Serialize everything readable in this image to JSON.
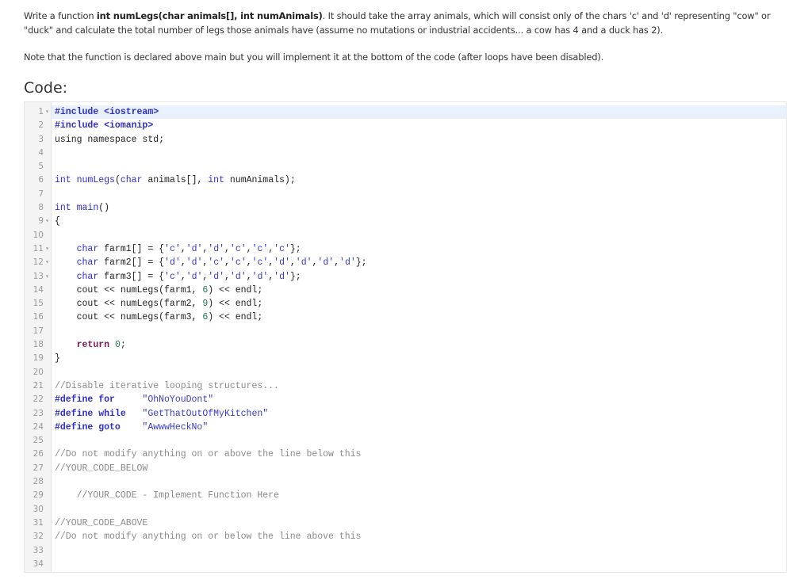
{
  "prompt": {
    "p1_pre": "Write a function ",
    "p1_bold": "int numLegs(char animals[], int numAnimals)",
    "p1_post": ". It should take the array animals, which will consist only of the chars 'c' and 'd' representing \"cow\" or \"duck\" and calculate the total number of legs those animals have (assume no mutations or industrial accidents... a cow has 4 and a duck has 2).",
    "p2": "Note that the function is declared above main but you will implement it at the bottom of the code (after loops have been disabled)."
  },
  "heading": "Code:",
  "editor": {
    "active_line": 1,
    "lines": [
      {
        "n": "1",
        "fold": true,
        "tokens": [
          {
            "t": "pp",
            "v": "#include <iostream>"
          }
        ]
      },
      {
        "n": "2",
        "fold": false,
        "tokens": [
          {
            "t": "pp",
            "v": "#include <iomanip>"
          }
        ]
      },
      {
        "n": "3",
        "fold": false,
        "tokens": [
          {
            "t": "",
            "v": "using namespace std;"
          }
        ]
      },
      {
        "n": "4",
        "fold": false,
        "tokens": []
      },
      {
        "n": "5",
        "fold": false,
        "tokens": []
      },
      {
        "n": "6",
        "fold": false,
        "tokens": [
          {
            "t": "kw",
            "v": "int"
          },
          {
            "t": "",
            "v": " "
          },
          {
            "t": "kw",
            "v": "numLegs"
          },
          {
            "t": "",
            "v": "("
          },
          {
            "t": "kw",
            "v": "char"
          },
          {
            "t": "",
            "v": " animals[], "
          },
          {
            "t": "kw",
            "v": "int"
          },
          {
            "t": "",
            "v": " numAnimals);"
          }
        ]
      },
      {
        "n": "7",
        "fold": false,
        "tokens": []
      },
      {
        "n": "8",
        "fold": false,
        "tokens": [
          {
            "t": "kw",
            "v": "int"
          },
          {
            "t": "",
            "v": " "
          },
          {
            "t": "kw",
            "v": "main"
          },
          {
            "t": "",
            "v": "()"
          }
        ]
      },
      {
        "n": "9",
        "fold": true,
        "tokens": [
          {
            "t": "",
            "v": "{"
          }
        ]
      },
      {
        "n": "10",
        "fold": false,
        "tokens": []
      },
      {
        "n": "11",
        "fold": true,
        "tokens": [
          {
            "t": "",
            "v": "    "
          },
          {
            "t": "kw",
            "v": "char"
          },
          {
            "t": "",
            "v": " farm1[] = {"
          },
          {
            "t": "str",
            "v": "'c'"
          },
          {
            "t": "",
            "v": ","
          },
          {
            "t": "str",
            "v": "'d'"
          },
          {
            "t": "",
            "v": ","
          },
          {
            "t": "str",
            "v": "'d'"
          },
          {
            "t": "",
            "v": ","
          },
          {
            "t": "str",
            "v": "'c'"
          },
          {
            "t": "",
            "v": ","
          },
          {
            "t": "str",
            "v": "'c'"
          },
          {
            "t": "",
            "v": ","
          },
          {
            "t": "str",
            "v": "'c'"
          },
          {
            "t": "",
            "v": "};"
          }
        ]
      },
      {
        "n": "12",
        "fold": true,
        "tokens": [
          {
            "t": "",
            "v": "    "
          },
          {
            "t": "kw",
            "v": "char"
          },
          {
            "t": "",
            "v": " farm2[] = {"
          },
          {
            "t": "str",
            "v": "'d'"
          },
          {
            "t": "",
            "v": ","
          },
          {
            "t": "str",
            "v": "'d'"
          },
          {
            "t": "",
            "v": ","
          },
          {
            "t": "str",
            "v": "'c'"
          },
          {
            "t": "",
            "v": ","
          },
          {
            "t": "str",
            "v": "'c'"
          },
          {
            "t": "",
            "v": ","
          },
          {
            "t": "str",
            "v": "'c'"
          },
          {
            "t": "",
            "v": ","
          },
          {
            "t": "str",
            "v": "'d'"
          },
          {
            "t": "",
            "v": ","
          },
          {
            "t": "str",
            "v": "'d'"
          },
          {
            "t": "",
            "v": ","
          },
          {
            "t": "str",
            "v": "'d'"
          },
          {
            "t": "",
            "v": ","
          },
          {
            "t": "str",
            "v": "'d'"
          },
          {
            "t": "",
            "v": "};"
          }
        ]
      },
      {
        "n": "13",
        "fold": true,
        "tokens": [
          {
            "t": "",
            "v": "    "
          },
          {
            "t": "kw",
            "v": "char"
          },
          {
            "t": "",
            "v": " farm3[] = {"
          },
          {
            "t": "str",
            "v": "'c'"
          },
          {
            "t": "",
            "v": ","
          },
          {
            "t": "str",
            "v": "'d'"
          },
          {
            "t": "",
            "v": ","
          },
          {
            "t": "str",
            "v": "'d'"
          },
          {
            "t": "",
            "v": ","
          },
          {
            "t": "str",
            "v": "'d'"
          },
          {
            "t": "",
            "v": ","
          },
          {
            "t": "str",
            "v": "'d'"
          },
          {
            "t": "",
            "v": ","
          },
          {
            "t": "str",
            "v": "'d'"
          },
          {
            "t": "",
            "v": "};"
          }
        ]
      },
      {
        "n": "14",
        "fold": false,
        "tokens": [
          {
            "t": "",
            "v": "    cout << numLegs(farm1, "
          },
          {
            "t": "num",
            "v": "6"
          },
          {
            "t": "",
            "v": ") << endl;"
          }
        ]
      },
      {
        "n": "15",
        "fold": false,
        "tokens": [
          {
            "t": "",
            "v": "    cout << numLegs(farm2, "
          },
          {
            "t": "num",
            "v": "9"
          },
          {
            "t": "",
            "v": ") << endl;"
          }
        ]
      },
      {
        "n": "16",
        "fold": false,
        "tokens": [
          {
            "t": "",
            "v": "    cout << numLegs(farm3, "
          },
          {
            "t": "num",
            "v": "6"
          },
          {
            "t": "",
            "v": ") << endl;"
          }
        ]
      },
      {
        "n": "17",
        "fold": false,
        "tokens": []
      },
      {
        "n": "18",
        "fold": false,
        "tokens": [
          {
            "t": "",
            "v": "    "
          },
          {
            "t": "ret",
            "v": "return"
          },
          {
            "t": "",
            "v": " "
          },
          {
            "t": "num",
            "v": "0"
          },
          {
            "t": "",
            "v": ";"
          }
        ]
      },
      {
        "n": "19",
        "fold": false,
        "tokens": [
          {
            "t": "",
            "v": "}"
          }
        ]
      },
      {
        "n": "20",
        "fold": false,
        "tokens": []
      },
      {
        "n": "21",
        "fold": false,
        "tokens": [
          {
            "t": "cm",
            "v": "//Disable iterative looping structures..."
          }
        ]
      },
      {
        "n": "22",
        "fold": false,
        "tokens": [
          {
            "t": "pp",
            "v": "#define for     "
          },
          {
            "t": "str",
            "v": "\"OhNoYouDont\""
          }
        ]
      },
      {
        "n": "23",
        "fold": false,
        "tokens": [
          {
            "t": "pp",
            "v": "#define while   "
          },
          {
            "t": "str",
            "v": "\"GetThatOutOfMyKitchen\""
          }
        ]
      },
      {
        "n": "24",
        "fold": false,
        "tokens": [
          {
            "t": "pp",
            "v": "#define goto    "
          },
          {
            "t": "str",
            "v": "\"AwwwHeckNo\""
          }
        ]
      },
      {
        "n": "25",
        "fold": false,
        "tokens": []
      },
      {
        "n": "26",
        "fold": false,
        "tokens": [
          {
            "t": "cm",
            "v": "//Do not modify anything on or above the line below this"
          }
        ]
      },
      {
        "n": "27",
        "fold": false,
        "tokens": [
          {
            "t": "cm",
            "v": "//YOUR_CODE_BELOW"
          }
        ]
      },
      {
        "n": "28",
        "fold": false,
        "tokens": []
      },
      {
        "n": "29",
        "fold": false,
        "tokens": [
          {
            "t": "cm",
            "v": "    //YOUR_CODE - Implement Function Here"
          }
        ]
      },
      {
        "n": "30",
        "fold": false,
        "tokens": []
      },
      {
        "n": "31",
        "fold": false,
        "tokens": [
          {
            "t": "cm",
            "v": "//YOUR_CODE_ABOVE"
          }
        ]
      },
      {
        "n": "32",
        "fold": false,
        "tokens": [
          {
            "t": "cm",
            "v": "//Do not modify anything on or below the line above this"
          }
        ]
      },
      {
        "n": "33",
        "fold": false,
        "tokens": []
      },
      {
        "n": "34",
        "fold": false,
        "tokens": []
      }
    ]
  },
  "icons": {
    "fold": "▾"
  }
}
